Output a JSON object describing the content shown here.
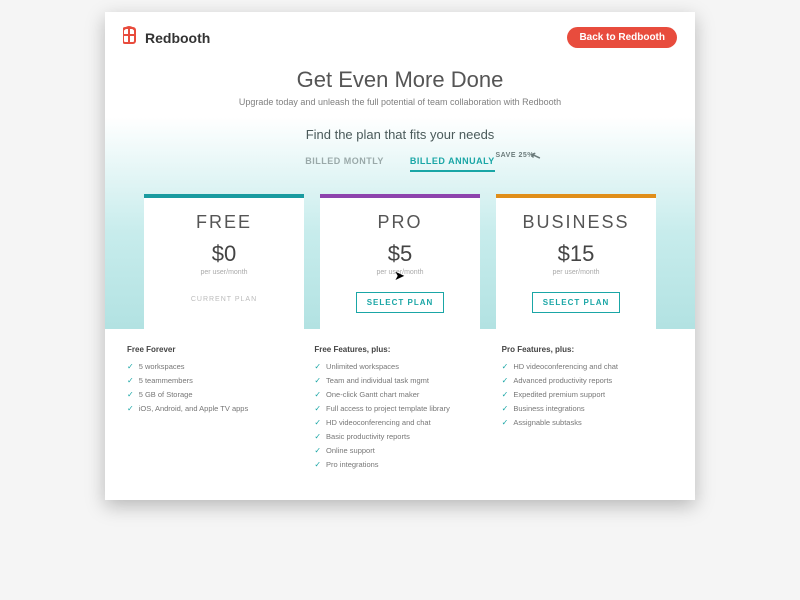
{
  "header": {
    "brand": "Redbooth",
    "back_prefix": "Back to ",
    "back_bold": "Redbooth"
  },
  "hero": {
    "title": "Get Even More Done",
    "subtitle": "Upgrade today and unleash the full potential of team collaboration with Redbooth"
  },
  "finder": "Find the plan that fits your needs",
  "billing": {
    "monthly": "BILLED MONTLY",
    "annually": "BILLED ANNUALY",
    "save": "SAVE 25%"
  },
  "plans": [
    {
      "name": "FREE",
      "price": "$0",
      "per": "per user/month",
      "cta": "CURRENT PLAN",
      "current": true
    },
    {
      "name": "PRO",
      "price": "$5",
      "per": "per user/month",
      "cta": "SELECT PLAN",
      "current": false
    },
    {
      "name": "BUSINESS",
      "price": "$15",
      "per": "per user/month",
      "cta": "SELECT PLAN",
      "current": false
    }
  ],
  "features": {
    "free": {
      "heading": "Free Forever",
      "items": [
        "5 workspaces",
        "5 teammembers",
        "5 GB of Storage",
        "iOS, Android, and Apple TV apps"
      ]
    },
    "pro": {
      "heading": "Free Features, plus:",
      "items": [
        "Unlimited workspaces",
        "Team and individual task mgmt",
        "One-click Gantt chart maker",
        "Full access to project template library",
        "HD videoconferencing and chat",
        "Basic productivity reports",
        "Online support",
        "Pro integrations"
      ]
    },
    "business": {
      "heading": "Pro Features, plus:",
      "items": [
        "HD videoconferencing and chat",
        "Advanced productivity reports",
        "Expedited premium support",
        "Business integrations",
        "Assignable subtasks"
      ]
    }
  }
}
